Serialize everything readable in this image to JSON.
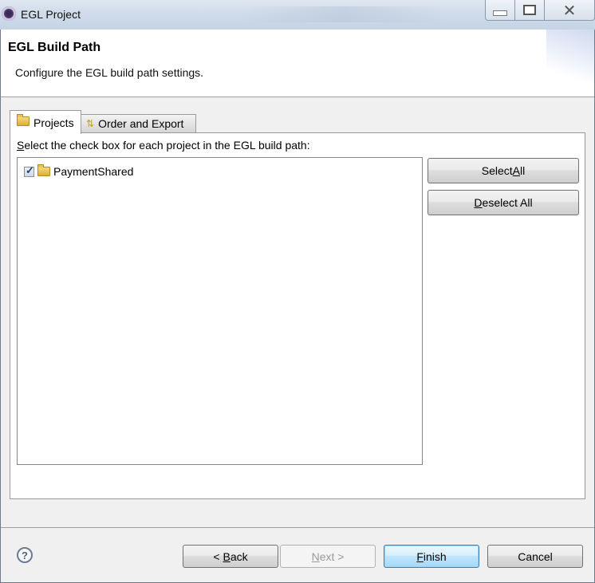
{
  "window": {
    "title": "EGL Project",
    "icon": "eclipse-gear-icon",
    "controls": {
      "minimize": "minimize-icon",
      "maximize": "maximize-icon",
      "close": "close-icon"
    }
  },
  "banner": {
    "title": "EGL Build Path",
    "description": "Configure the EGL build path settings."
  },
  "tabs": [
    {
      "label": "Projects",
      "icon": "folder-icon",
      "selected": true
    },
    {
      "label": "Order and Export",
      "icon": "order-export-icon",
      "selected": false
    }
  ],
  "projects_tab": {
    "instruction_prefix": "S",
    "instruction_rest": "elect the check box for each project in the EGL build path:",
    "projects": [
      {
        "name": "PaymentShared",
        "checked": true,
        "icon": "folder-icon"
      }
    ],
    "buttons": {
      "select_all": {
        "pre": "Select ",
        "mnemonic": "A",
        "post": "ll"
      },
      "deselect_all": {
        "pre": "",
        "mnemonic": "D",
        "post": "eselect All"
      }
    }
  },
  "footer": {
    "help_icon": "help-icon",
    "help_glyph": "?",
    "back": {
      "pre": "< ",
      "mnemonic": "B",
      "post": "ack",
      "enabled": true
    },
    "next": {
      "pre": "",
      "mnemonic": "N",
      "post": "ext >",
      "enabled": false
    },
    "finish": {
      "pre": "",
      "mnemonic": "F",
      "post": "inish",
      "enabled": true,
      "default": true
    },
    "cancel": {
      "label": "Cancel",
      "enabled": true
    }
  }
}
